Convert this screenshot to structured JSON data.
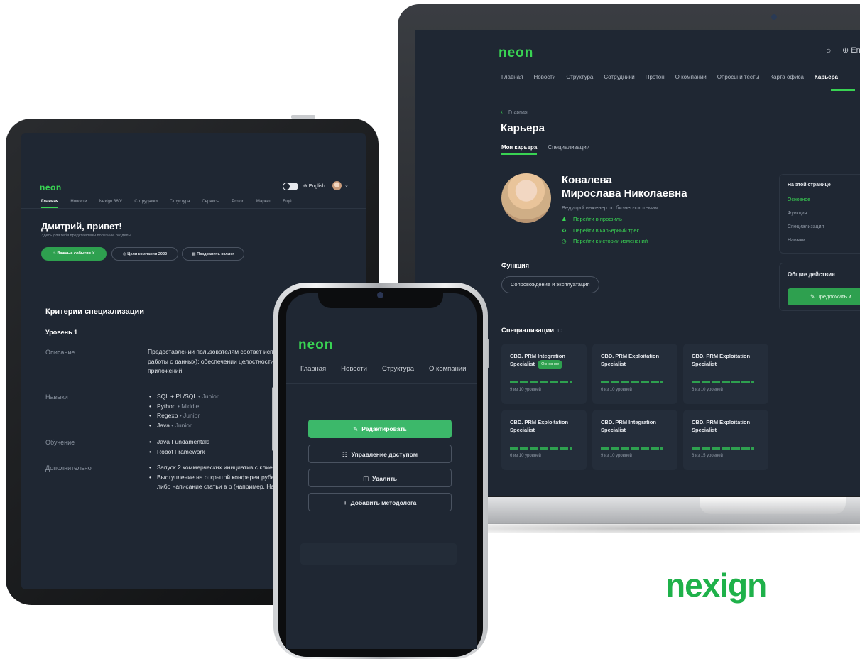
{
  "brand": {
    "logo_text": "nexign",
    "color": "#1fb14a"
  },
  "colors": {
    "accent": "#39d353",
    "screen_bg": "#1f2733",
    "card_bg": "#242d3a"
  },
  "laptop": {
    "logo": "neon",
    "search_icon": "search-icon",
    "lang": "⊕ En",
    "nav": [
      "Главная",
      "Новости",
      "Структура",
      "Сотрудники",
      "Протон",
      "О компании",
      "Опросы и тесты",
      "Карта офиса",
      "Карьера"
    ],
    "active_nav": "Карьера",
    "breadcrumb": "Главная",
    "title": "Карьера",
    "tabs": [
      "Моя карьера",
      "Специализации"
    ],
    "profile": {
      "surname": "Ковалева",
      "name": "Мирослава Николаевна",
      "role": "Ведущий инженер по бизнес-системам",
      "links": [
        "Перейти в профиль",
        "Перейти в карьерный трек",
        "Перейти к истории изменений"
      ]
    },
    "function_title": "Функция",
    "function_chip": "Сопровождение и эксплуатация",
    "on_page": {
      "title": "На этой странице",
      "items": [
        "Основное",
        "Функция",
        "Специализация",
        "Навыки"
      ]
    },
    "actions": {
      "title": "Общие действия",
      "button": "Предложить и"
    },
    "specs_title": "Специализации",
    "specs_count": "10",
    "spec_cards": [
      {
        "title": "CBD. PRM Integration Specialist",
        "badge": "Основное",
        "levels": "9 из 10 уровней"
      },
      {
        "title": "CBD. PRM Exploitation Specialist",
        "badge": "",
        "levels": "6 из 10 уровней"
      },
      {
        "title": "CBD. PRM Exploitation Specialist",
        "badge": "",
        "levels": "6 из 10 уровней"
      },
      {
        "title": "CBD. PRM Exploitation Specialist",
        "badge": "",
        "levels": "6 из 10 уровней"
      },
      {
        "title": "CBD. PRM Integration Specialist",
        "badge": "",
        "levels": "9 из 10 уровней"
      },
      {
        "title": "CBD. PRM Exploitation Specialist",
        "badge": "",
        "levels": "6 из 15 уровней"
      }
    ]
  },
  "tablet": {
    "logo": "neon",
    "lang": "⊕ English",
    "nav": [
      "Главная",
      "Новости",
      "Nexign 360°",
      "Сотрудники",
      "Структура",
      "Сервисы",
      "Proton",
      "Маркет",
      "Ещё"
    ],
    "greeting": "Дмитрий, привет!",
    "subtitle": "Здесь для тебя представлены полезные разделы",
    "buttons": [
      "Важные события",
      "Цели компании 2022",
      "Поздравить коллег"
    ],
    "criteria_title": "Критерии специализации",
    "level": "Уровень 1",
    "labels": {
      "desc": "Описание",
      "skills": "Навыки",
      "learning": "Обучение",
      "extra": "Дополнительно"
    },
    "description": "Предоставлении пользователям соответ использования возможностей работы с данных); обеспечении целостности дан многопользовательских приложений.",
    "skills": [
      {
        "name": "SQL + PL/SQL",
        "level": "Junior"
      },
      {
        "name": "Python",
        "level": "Middle"
      },
      {
        "name": "Regexp",
        "level": "Junior"
      },
      {
        "name": "Java",
        "level": "Junior"
      }
    ],
    "learning": [
      "Java Fundamentals",
      "Robot Framework"
    ],
    "extra": [
      "Запуск 2 коммерческих инициатив с клиентами",
      "Выступление на открытой конферен рубежом, либо написание статьи в о (например, Habr)"
    ]
  },
  "phone": {
    "logo": "neon",
    "nav": [
      "Главная",
      "Новости",
      "Структура",
      "О компании"
    ],
    "buttons": {
      "edit": "Редактировать",
      "access": "Управление доступом",
      "delete": "Удалить",
      "add": "Добавить методолога"
    }
  }
}
